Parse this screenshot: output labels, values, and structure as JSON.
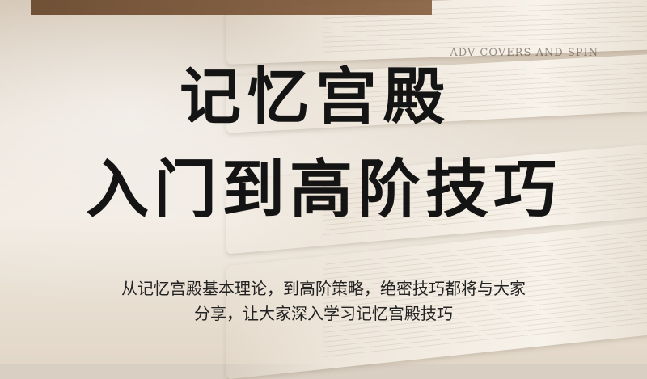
{
  "banner": {
    "text": ""
  },
  "book": {
    "spine_text": "ADV COVERS AND SPIN"
  },
  "title": {
    "line1": "记忆宫殿",
    "line2": "入门到高阶技巧"
  },
  "description": {
    "line1": "从记忆宫殿基本理论，到高阶策略，绝密技巧都将与大家",
    "line2": "分享，让大家深入学习记忆宫殿技巧"
  },
  "footer": {
    "text": ""
  },
  "colors": {
    "title": "#141414",
    "banner": "#6b4a2f",
    "background": "#e6ddd1"
  }
}
